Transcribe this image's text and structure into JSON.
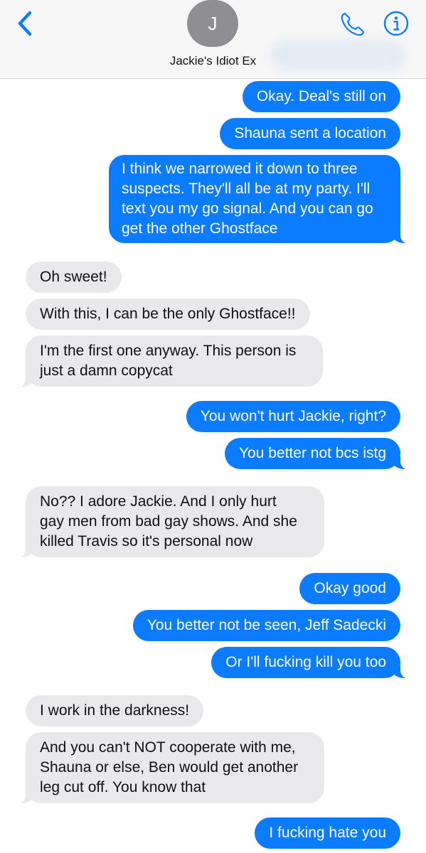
{
  "header": {
    "avatar_initial": "J",
    "contact_name": "Jackie's Idiot Ex",
    "back_icon": "chevron-left-icon",
    "call_icon": "phone-icon",
    "info_icon": "info-icon",
    "accent_color": "#0b7cff"
  },
  "messages": [
    {
      "direction": "outgoing",
      "lines": [
        "Okay. Deal's still on"
      ]
    },
    {
      "direction": "outgoing",
      "lines": [
        "Shauna sent a location"
      ]
    },
    {
      "direction": "outgoing",
      "lines": [
        "I think we narrowed it down to three",
        "suspects. They'll all be at my party. I'll",
        "text you my go signal. And you can go",
        "get the other Ghostface"
      ]
    },
    {
      "direction": "incoming",
      "lines": [
        "Oh sweet!"
      ]
    },
    {
      "direction": "incoming",
      "lines": [
        "With this, I can be the only Ghostface!!"
      ]
    },
    {
      "direction": "incoming",
      "lines": [
        "I'm the first one anyway. This person is",
        "just a damn copycat"
      ]
    },
    {
      "direction": "outgoing",
      "lines": [
        "You won't hurt Jackie, right?"
      ]
    },
    {
      "direction": "outgoing",
      "lines": [
        "You better not bcs istg"
      ]
    },
    {
      "direction": "incoming",
      "lines": [
        "No?? I adore Jackie. And I only hurt",
        "gay men from bad gay shows. And she",
        "killed Travis so it's personal now"
      ]
    },
    {
      "direction": "outgoing",
      "lines": [
        "Okay good"
      ]
    },
    {
      "direction": "outgoing",
      "lines": [
        "You better not be seen, Jeff Sadecki"
      ]
    },
    {
      "direction": "outgoing",
      "lines": [
        "Or I'll fucking kill you too"
      ]
    },
    {
      "direction": "incoming",
      "lines": [
        "I work in the darkness!"
      ]
    },
    {
      "direction": "incoming",
      "lines": [
        "And you can't NOT cooperate with me,",
        "Shauna or else, Ben would get another",
        "leg cut off. You know that"
      ]
    },
    {
      "direction": "outgoing",
      "lines": [
        "I fucking hate you"
      ]
    }
  ]
}
